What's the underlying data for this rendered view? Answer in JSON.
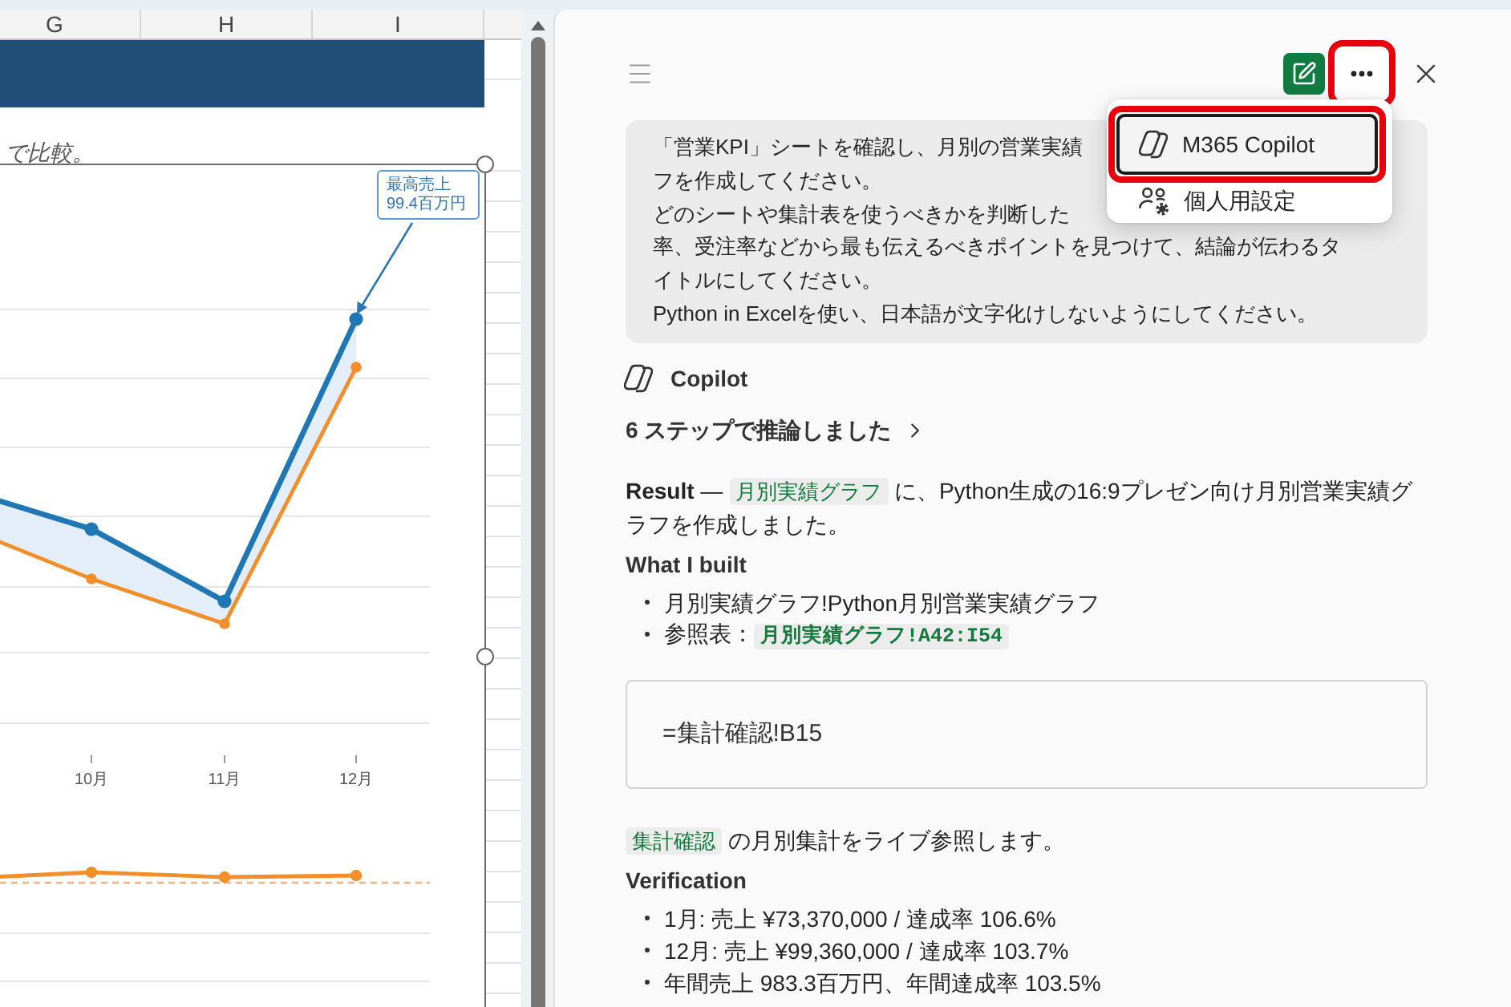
{
  "sheet": {
    "column_headers": [
      "G",
      "H",
      "I"
    ],
    "note": "で比較。",
    "chart": {
      "callout": [
        "最高売上",
        "99.4百万円"
      ],
      "x_labels": [
        "10月",
        "11月",
        "12月"
      ]
    }
  },
  "panel": {
    "toolbar": {
      "more_button": {
        "highlighted": true
      }
    },
    "menu": {
      "items": [
        {
          "label": "M365 Copilot",
          "kind": "copilot",
          "selected": true,
          "highlighted": true
        },
        {
          "label": "個人用設定",
          "kind": "settings",
          "selected": false,
          "highlighted": false
        }
      ]
    },
    "user_message": {
      "lines": [
        "「営業KPI」シートを確認し、月別の営業実績",
        "フを作成してください。",
        "どのシートや集計表を使うべきかを判断した",
        "率、受注率などから最も伝えるべきポイントを見つけて、結論が伝わるタ",
        "イトルにしてください。",
        "Python in Excelを使い、日本語が文字化けしないようにしてください。"
      ]
    },
    "response": {
      "author": "Copilot",
      "reasoning": {
        "label": "6 ステップで推論しました",
        "expanded": false
      },
      "blocks": [
        {
          "kind": "paragraph",
          "segments": [
            {
              "kind": "text",
              "text": "**Result** — "
            },
            {
              "kind": "ref",
              "text": "月別実績グラフ"
            },
            {
              "kind": "text",
              "text": " に、Python生成の16:9プレゼン向け月別営業実績グラフを作成しました。"
            }
          ]
        },
        {
          "kind": "heading",
          "text": "What I built"
        },
        {
          "kind": "list",
          "items": [
            [
              {
                "kind": "text",
                "text": "月別実績グラフ!Python月別営業実績グラフ"
              }
            ],
            [
              {
                "kind": "text",
                "text": "参照表："
              },
              {
                "kind": "code",
                "text": "月別実績グラフ!A42:I54"
              }
            ]
          ]
        },
        {
          "kind": "code",
          "text": "=集計確認!B15"
        },
        {
          "kind": "paragraph",
          "segments": [
            {
              "kind": "ref",
              "text": "集計確認"
            },
            {
              "kind": "text",
              "text": " の月別集計をライブ参照します。"
            }
          ]
        },
        {
          "kind": "heading",
          "text": "Verification"
        },
        {
          "kind": "list",
          "items": [
            [
              {
                "kind": "text",
                "text": "1月: 売上 ¥73,370,000 / 達成率 106.6%"
              }
            ],
            [
              {
                "kind": "text",
                "text": "12月: 売上 ¥99,360,000 / 達成率 103.7%"
              }
            ],
            [
              {
                "kind": "text",
                "text": "年間売上 983.3百万円、年間達成率 103.5%"
              }
            ]
          ]
        }
      ]
    }
  }
}
